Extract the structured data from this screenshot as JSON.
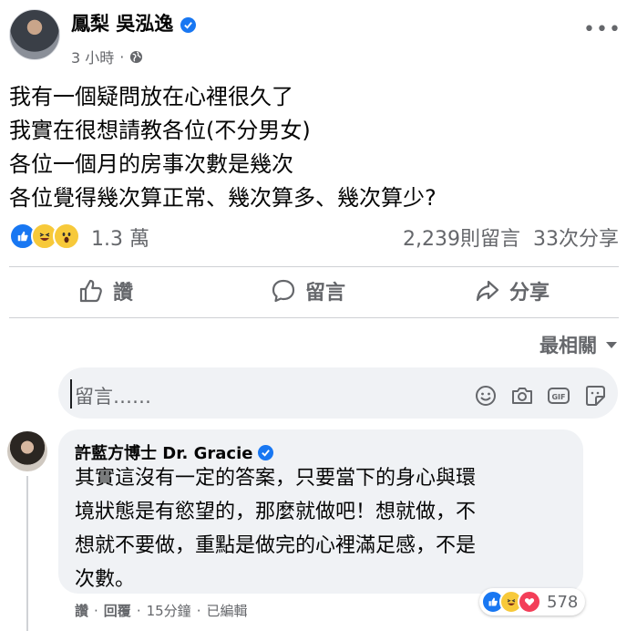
{
  "post": {
    "author": "鳳梨 吳泓逸",
    "time": "3 小時",
    "separator": "·",
    "body_lines": [
      "我有一個疑問放在心裡很久了",
      "我實在很想請教各位(不分男女)",
      "各位一個月的房事次數是幾次",
      "各位覺得幾次算正常、幾次算多、幾次算少?"
    ],
    "reaction_count": "1.3 萬",
    "comment_count": "2,239則留言",
    "share_count": "33次分享",
    "icons": [
      "verified-badge",
      "globe-icon",
      "more-options-icon"
    ]
  },
  "actions": {
    "like": "讚",
    "comment": "留言",
    "share": "分享"
  },
  "sort": {
    "label": "最相關"
  },
  "comment_input": {
    "placeholder": "留言……",
    "icons": [
      "emoji-icon",
      "camera-icon",
      "gif-icon",
      "sticker-icon"
    ]
  },
  "comment": {
    "author": "許藍方博士 Dr. Gracie",
    "text_lines": [
      "其實這沒有一定的答案，只要當下的身心與環",
      "境狀態是有慾望的，那麼就做吧！想就做，不",
      "想就不要做，重點是做完的心裡滿足感，不是",
      "次數。"
    ],
    "like_label": "讚",
    "reply_label": "回覆",
    "time": "15分鐘",
    "edited": "已編輯",
    "reaction_count": "578"
  },
  "colors": {
    "accent": "#1877f2",
    "secondary_text": "#65676b",
    "bubble": "#f0f2f5"
  }
}
